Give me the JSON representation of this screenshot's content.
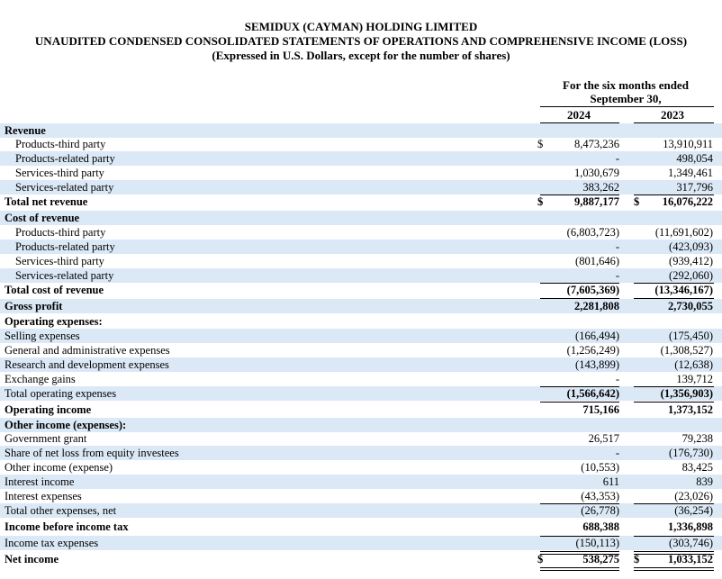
{
  "header": {
    "company": "SEMIDUX (CAYMAN) HOLDING LIMITED",
    "title": "UNAUDITED CONDENSED CONSOLIDATED STATEMENTS OF OPERATIONS AND COMPREHENSIVE INCOME (LOSS)",
    "subtitle": "(Expressed in U.S. Dollars, except for the number of shares)"
  },
  "columns": {
    "period_line1": "For the six months ended",
    "period_line2": "September 30,",
    "year1": "2024",
    "year2": "2023"
  },
  "rows": [
    {
      "label": "Revenue",
      "c1": "",
      "v1": "",
      "c2": "",
      "v2": ""
    },
    {
      "label": "Products-third party",
      "c1": "$",
      "v1": "8,473,236",
      "c2": "",
      "v2": "13,910,911"
    },
    {
      "label": "Products-related party",
      "c1": "",
      "v1": "-",
      "c2": "",
      "v2": "498,054"
    },
    {
      "label": "Services-third party",
      "c1": "",
      "v1": "1,030,679",
      "c2": "",
      "v2": "1,349,461"
    },
    {
      "label": "Services-related party",
      "c1": "",
      "v1": "383,262",
      "c2": "",
      "v2": "317,796"
    },
    {
      "label": "Total net revenue",
      "c1": "$",
      "v1": "9,887,177",
      "c2": "$",
      "v2": "16,076,222"
    },
    {
      "label": "Cost of revenue",
      "c1": "",
      "v1": "",
      "c2": "",
      "v2": ""
    },
    {
      "label": "Products-third party",
      "c1": "",
      "v1": "(6,803,723)",
      "c2": "",
      "v2": "(11,691,602)"
    },
    {
      "label": "Products-related party",
      "c1": "",
      "v1": "-",
      "c2": "",
      "v2": "(423,093)"
    },
    {
      "label": "Services-third party",
      "c1": "",
      "v1": "(801,646)",
      "c2": "",
      "v2": "(939,412)"
    },
    {
      "label": "Services-related party",
      "c1": "",
      "v1": "-",
      "c2": "",
      "v2": "(292,060)"
    },
    {
      "label": "Total cost of revenue",
      "c1": "",
      "v1": "(7,605,369)",
      "c2": "",
      "v2": "(13,346,167)"
    },
    {
      "label": "Gross profit",
      "c1": "",
      "v1": "2,281,808",
      "c2": "",
      "v2": "2,730,055"
    },
    {
      "label": "Operating expenses:",
      "c1": "",
      "v1": "",
      "c2": "",
      "v2": ""
    },
    {
      "label": "Selling expenses",
      "c1": "",
      "v1": "(166,494)",
      "c2": "",
      "v2": "(175,450)"
    },
    {
      "label": "General and administrative expenses",
      "c1": "",
      "v1": "(1,256,249)",
      "c2": "",
      "v2": "(1,308,527)"
    },
    {
      "label": "Research and development expenses",
      "c1": "",
      "v1": "(143,899)",
      "c2": "",
      "v2": "(12,638)"
    },
    {
      "label": "Exchange gains",
      "c1": "",
      "v1": "-",
      "c2": "",
      "v2": "139,712"
    },
    {
      "label": "Total operating expenses",
      "c1": "",
      "v1": "(1,566,642)",
      "c2": "",
      "v2": "(1,356,903)"
    },
    {
      "label": "Operating income",
      "c1": "",
      "v1": "715,166",
      "c2": "",
      "v2": "1,373,152"
    },
    {
      "label": "Other income (expenses):",
      "c1": "",
      "v1": "",
      "c2": "",
      "v2": ""
    },
    {
      "label": "Government grant",
      "c1": "",
      "v1": "26,517",
      "c2": "",
      "v2": "79,238"
    },
    {
      "label": "Share of net loss from equity investees",
      "c1": "",
      "v1": "-",
      "c2": "",
      "v2": "(176,730)"
    },
    {
      "label": "Other income (expense)",
      "c1": "",
      "v1": "(10,553)",
      "c2": "",
      "v2": "83,425"
    },
    {
      "label": "Interest income",
      "c1": "",
      "v1": "611",
      "c2": "",
      "v2": "839"
    },
    {
      "label": "Interest expenses",
      "c1": "",
      "v1": "(43,353)",
      "c2": "",
      "v2": "(23,026)"
    },
    {
      "label": "Total other expenses, net",
      "c1": "",
      "v1": "(26,778)",
      "c2": "",
      "v2": "(36,254)"
    },
    {
      "label": "Income before income tax",
      "c1": "",
      "v1": "688,388",
      "c2": "",
      "v2": "1,336,898"
    },
    {
      "label": "Income tax expenses",
      "c1": "",
      "v1": "(150,113)",
      "c2": "",
      "v2": "(303,746)"
    },
    {
      "label": "Net income",
      "c1": "$",
      "v1": "538,275",
      "c2": "$",
      "v2": "1,033,152"
    }
  ]
}
